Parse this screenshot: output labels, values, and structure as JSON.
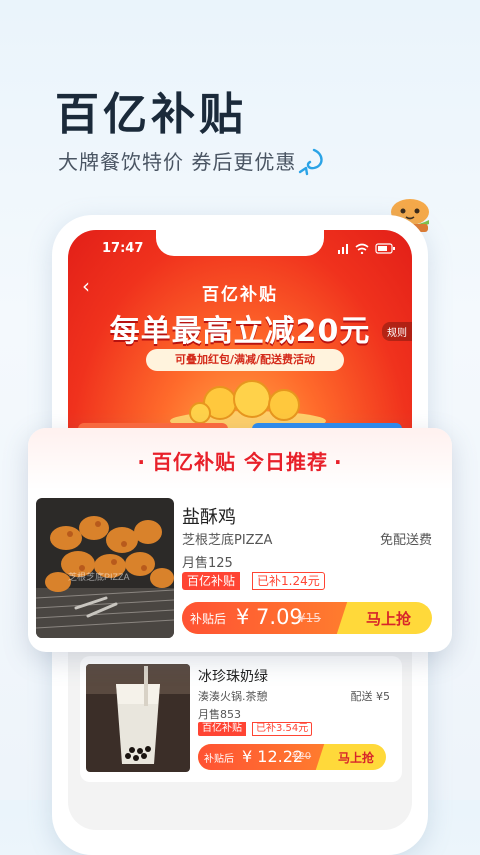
{
  "hero": {
    "headline": "百亿补贴",
    "subline": "大牌餐饮特价  券后更优惠"
  },
  "phone": {
    "status_time": "17:47",
    "banner_title": "百亿补贴",
    "banner_big": "每单最高立减20元",
    "rule_label": "规则",
    "pill_text": "可叠加红包/满减/配送费活动"
  },
  "recommend": {
    "title": "百亿补贴 今日推荐",
    "dot": "·"
  },
  "items": [
    {
      "name": "盐酥鸡",
      "shop": "芝根芝底PIZZA",
      "delivery": "免配送费",
      "monthly_sales": "月售125",
      "tag": "百亿补贴",
      "subsidy": "已补1.24元",
      "price_label": "补贴后",
      "price": "¥ 7.09",
      "old_price": "¥15",
      "cta": "马上抢",
      "photo_watermark": "芝根芝底PIZZA"
    },
    {
      "name": "冰珍珠奶绿",
      "shop": "湊湊火锅.茶憩",
      "delivery": "配送 ¥5",
      "monthly_sales": "月售853",
      "tag": "百亿补贴",
      "subsidy": "已补3.54元",
      "price_label": "补贴后",
      "price": "¥ 12.22",
      "old_price": "¥20",
      "cta": "马上抢"
    }
  ],
  "colors": {
    "accent_red": "#e8202a",
    "cta_yellow": "#ffd93a",
    "headline": "#1b2a3a"
  },
  "icons": [
    "swirl-arrow-icon",
    "burger-mascot-icon",
    "back-arrow-icon",
    "signal-icon",
    "wifi-icon",
    "battery-icon",
    "lightning-icon"
  ]
}
